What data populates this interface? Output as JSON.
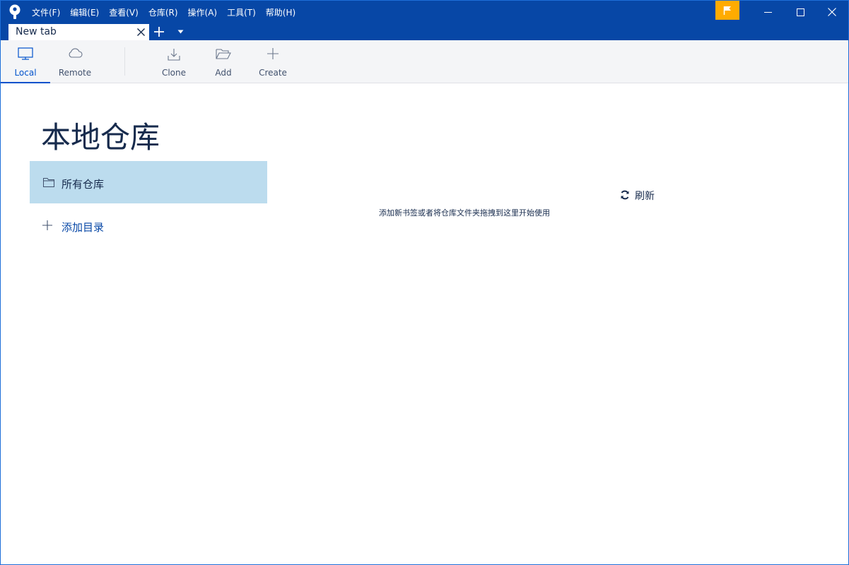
{
  "titlebar": {
    "menu": [
      "文件(F)",
      "编辑(E)",
      "查看(V)",
      "仓库(R)",
      "操作(A)",
      "工具(T)",
      "帮助(H)"
    ],
    "background_color": "#0747a6",
    "flag_color": "#ffab00"
  },
  "tabs": [
    {
      "label": "New tab"
    }
  ],
  "toolbar": {
    "local_label": "Local",
    "remote_label": "Remote",
    "clone_label": "Clone",
    "add_label": "Add",
    "create_label": "Create",
    "accent_color": "#0052cc"
  },
  "main": {
    "title": "本地仓库",
    "sidebar_all_label": "所有仓库",
    "sidebar_all_color": "#bcdcee",
    "add_directory_label": "添加目录",
    "refresh_label": "刷新",
    "empty_hint": "添加新书签或者将仓库文件夹拖拽到这里开始使用"
  },
  "icons": [
    "app-logo-icon",
    "flag-icon",
    "minimize-icon",
    "maximize-icon",
    "close-icon",
    "tab-close-icon",
    "add-tab-icon",
    "chevron-down-icon",
    "monitor-icon",
    "cloud-icon",
    "download-icon",
    "folder-open-icon",
    "plus-icon",
    "folder-icon",
    "refresh-icon"
  ]
}
